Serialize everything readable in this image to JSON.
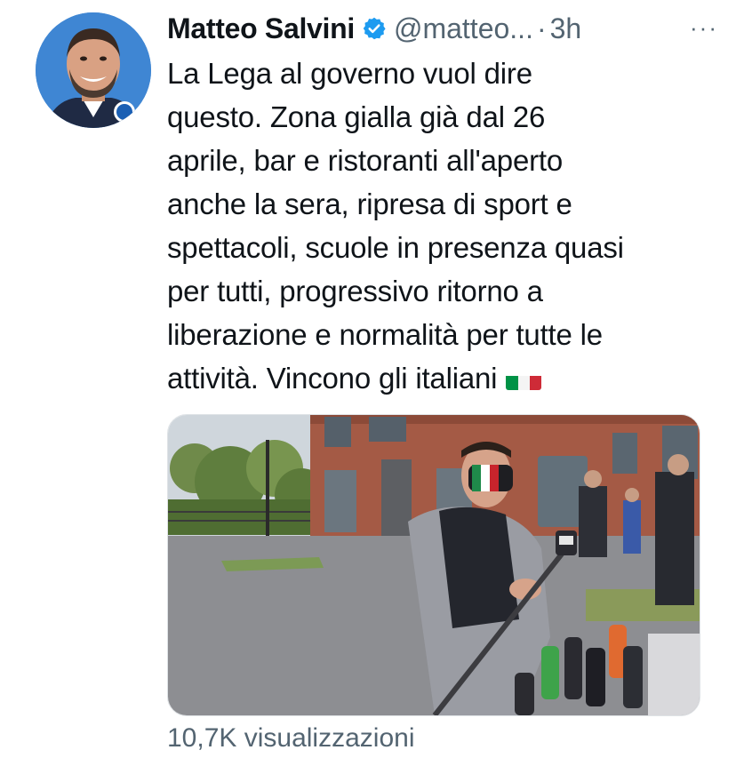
{
  "tweet": {
    "author_name": "Matteo Salvini",
    "verified_icon": "verified-badge-icon",
    "handle": "@matteo...",
    "separator": "·",
    "time": "3h",
    "more_icon": "···",
    "text_lines": [
      "La Lega al governo vuol dire",
      "questo. Zona gialla già dal 26",
      "aprile, bar e ristoranti all'aperto",
      "anche la sera, ripresa di sport e",
      "spettacoli, scuole in presenza quasi",
      "per tutti, progressivo ritorno a",
      "liberazione e normalità per tutte le",
      "attività. Vincono gli italiani"
    ],
    "flag_icon": "italy-flag-emoji",
    "views": "10,7K visualizzazioni"
  },
  "colors": {
    "verified": "#1d9bf0",
    "secondary_text": "#536471",
    "flag_green": "#009246",
    "flag_white": "#ffffff",
    "flag_red": "#ce2b37"
  }
}
